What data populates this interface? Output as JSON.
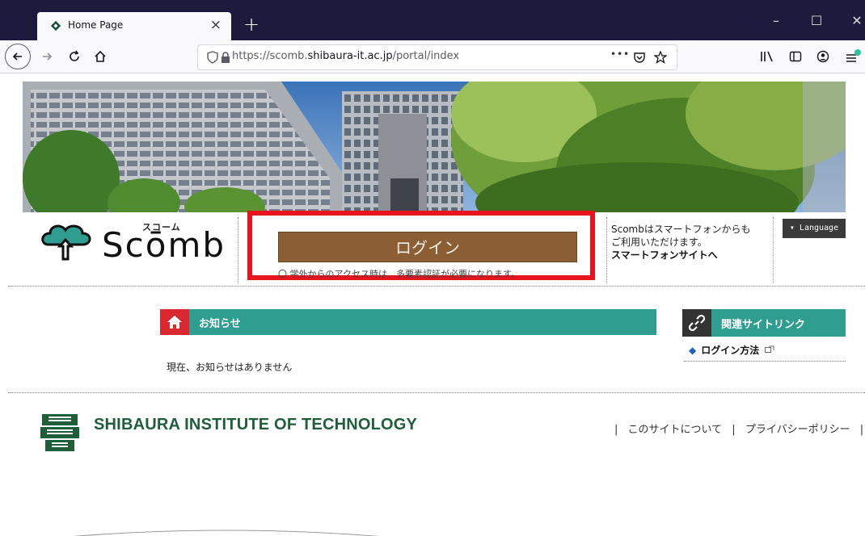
{
  "browser": {
    "tab_title": "Home Page",
    "url_prefix": "https://scomb.",
    "url_domain": "shibaura-it.ac.jp",
    "url_path": "/portal/index",
    "page_actions": "•••"
  },
  "header": {
    "logo_kana": "スコーム",
    "logo_word": "Scōmb",
    "login_label": "ログイン",
    "login_clipped_text": "〇 学外からのアクセス時は、多要素認証が必要になります。",
    "sp_notice_line1": "Scombはスマートフォンからも",
    "sp_notice_line2": "ご利用いただけます。",
    "sp_link": "スマートフォンサイトへ",
    "language_label": "▾ Language"
  },
  "notices": {
    "title": "お知らせ",
    "empty_text": "現在、お知らせはありません"
  },
  "related": {
    "title": "関連サイトリンク",
    "links": [
      "ログイン方法"
    ]
  },
  "footer": {
    "institute_name": "SHIBAURA INSTITUTE OF TECHNOLOGY",
    "links": [
      "このサイトについて",
      "プライバシーポリシー"
    ],
    "separator": "|"
  },
  "colors": {
    "accent_teal": "#2f9e91",
    "login_brown": "#8b5e34",
    "highlight_red": "#e8141d",
    "home_red": "#d9282f",
    "sit_green": "#1f5e3a"
  },
  "icons": {
    "tab": "scomb-favicon",
    "home": "home-icon",
    "link": "link-icon"
  }
}
